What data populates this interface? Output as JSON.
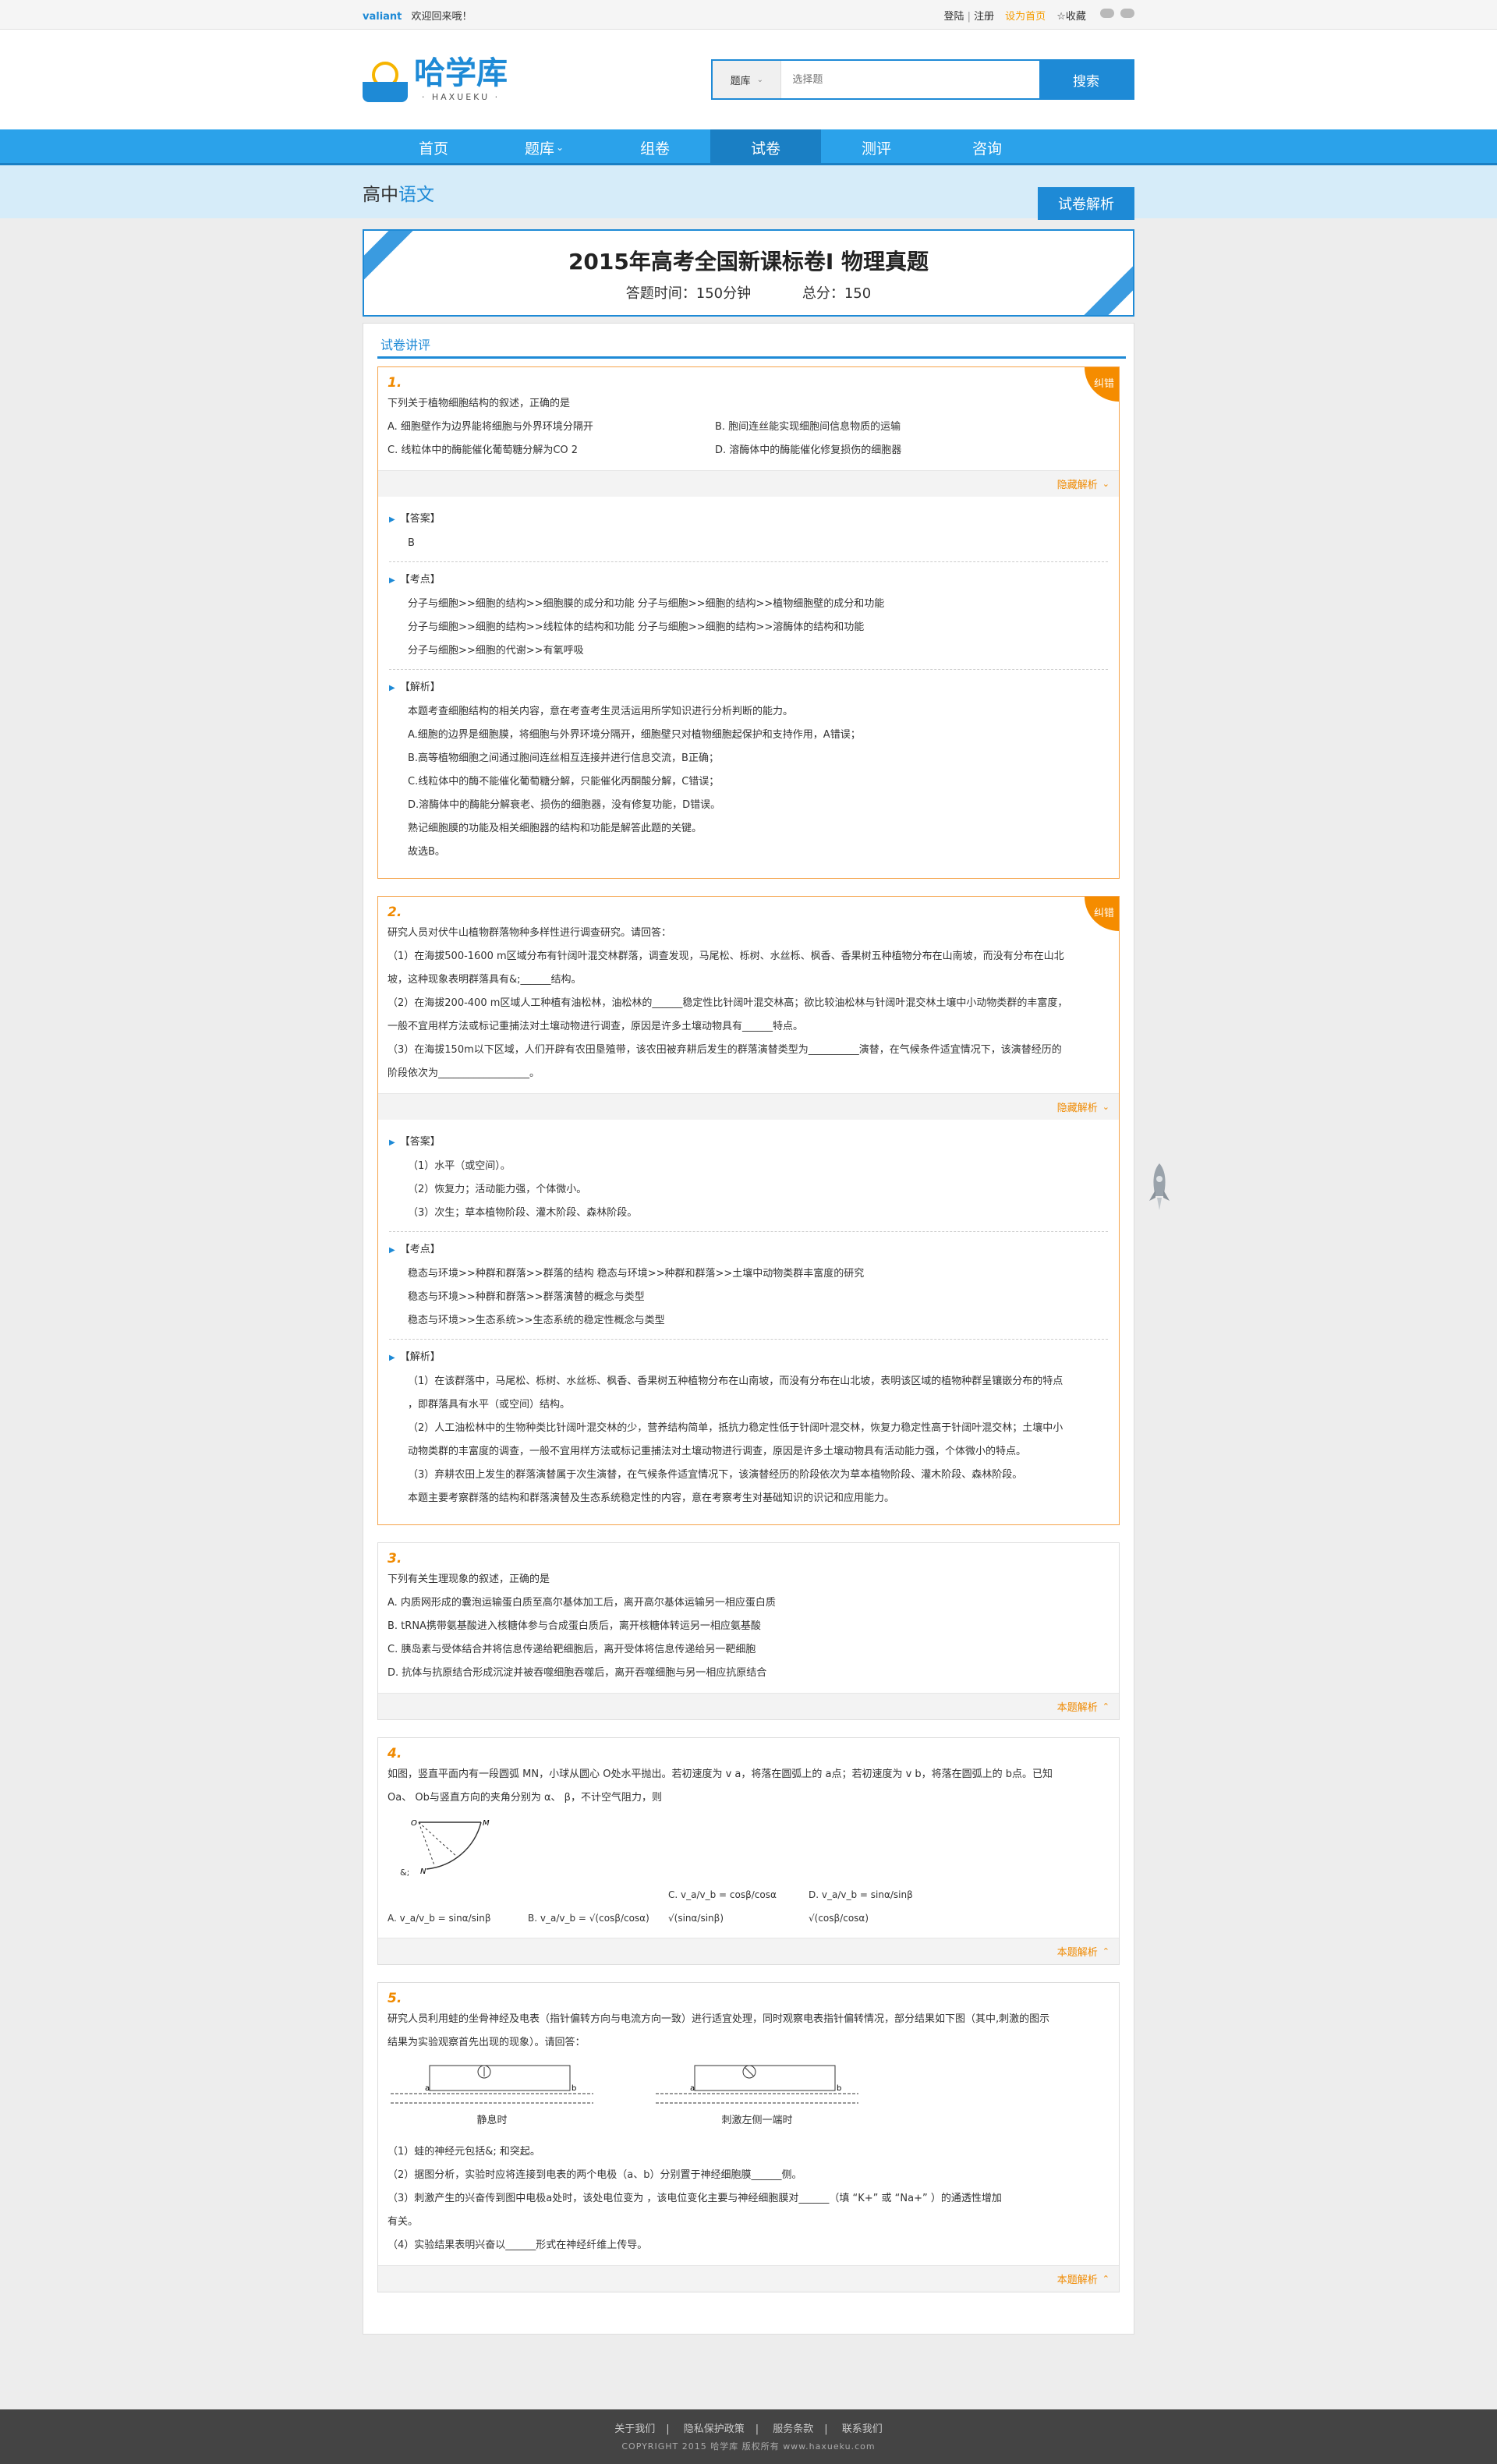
{
  "topbar": {
    "user": "valiant",
    "welcome": "欢迎回来哦！",
    "login": "登陆",
    "register": "注册",
    "set_home": "设为首页",
    "favorite": "收藏"
  },
  "header": {
    "logo_text": "哈学库",
    "logo_sub": "· HAXUEKU ·",
    "search_category": "题库",
    "search_placeholder": "选择题",
    "search_button": "搜索"
  },
  "nav": [
    "首页",
    "题库",
    "组卷",
    "试卷",
    "测评",
    "咨询"
  ],
  "nav_active": "试卷",
  "subhead": {
    "grade": "高中",
    "subject": "语文",
    "tag": "试卷解析"
  },
  "paper": {
    "title": "2015年高考全国新课标卷Ⅰ  物理真题",
    "time": "答题时间：150分钟",
    "score": "总分：150"
  },
  "section_title": "试卷讲评",
  "q1": {
    "num": "1.",
    "badge": "纠错",
    "stem": "下列关于植物细胞结构的叙述，正确的是",
    "opts": [
      "A.  细胞壁作为边界能将细胞与外界环境分隔开",
      "B.  胞间连丝能实现细胞间信息物质的运输",
      "C.  线粒体中的酶能催化葡萄糖分解为CO 2",
      "D.  溶酶体中的酶能催化修复损伤的细胞器"
    ],
    "toggle": "隐藏解析",
    "answer_h": "【答案】",
    "answer": [
      "B"
    ],
    "point_h": "【考点】",
    "points": [
      "分子与细胞>>细胞的结构>>细胞膜的成分和功能 分子与细胞>>细胞的结构>>植物细胞壁的成分和功能",
      "分子与细胞>>细胞的结构>>线粒体的结构和功能 分子与细胞>>细胞的结构>>溶酶体的结构和功能",
      "分子与细胞>>细胞的代谢>>有氧呼吸"
    ],
    "ana_h": "【解析】",
    "ana": [
      "本题考查细胞结构的相关内容，意在考查考生灵活运用所学知识进行分析判断的能力。",
      "A.细胞的边界是细胞膜，将细胞与外界环境分隔开，细胞壁只对植物细胞起保护和支持作用，A错误；",
      "B.高等植物细胞之间通过胞间连丝相互连接并进行信息交流，B正确；",
      "C.线粒体中的酶不能催化葡萄糖分解，只能催化丙酮酸分解，C错误；",
      "D.溶酶体中的酶能分解衰老、损伤的细胞器，没有修复功能，D错误。",
      "熟记细胞膜的功能及相关细胞器的结构和功能是解答此题的关键。",
      "故选B。"
    ]
  },
  "q2": {
    "num": "2.",
    "badge": "纠错",
    "lines": [
      "研究人员对伏牛山植物群落物种多样性进行调查研究。请回答：",
      "（1）在海拔500-1600 m区域分布有针阔叶混交林群落，调查发现，马尾松、栎树、水丝栎、枫香、香果树五种植物分布在山南坡，而没有分布在山北",
      "坡，这种现象表明群落具有&;______结构。",
      "（2）在海拔200-400 m区域人工种植有油松林，油松林的______稳定性比针阔叶混交林高；欲比较油松林与针阔叶混交林土壤中小动物类群的丰富度，",
      "一般不宜用样方法或标记重捕法对土壤动物进行调查，原因是许多土壤动物具有______特点。",
      "（3）在海拔150m以下区域，人们开辟有农田垦殖带，该农田被弃耕后发生的群落演替类型为__________演替，在气候条件适宜情况下，该演替经历的",
      "阶段依次为__________________。"
    ],
    "toggle": "隐藏解析",
    "answer_h": "【答案】",
    "answer": [
      "（1）水平（或空间）。",
      "（2）恢复力；活动能力强，个体微小。",
      "（3）次生；草本植物阶段、灌木阶段、森林阶段。"
    ],
    "point_h": "【考点】",
    "points": [
      "稳态与环境>>种群和群落>>群落的结构 稳态与环境>>种群和群落>>土壤中动物类群丰富度的研究",
      "稳态与环境>>种群和群落>>群落演替的概念与类型",
      "稳态与环境>>生态系统>>生态系统的稳定性概念与类型"
    ],
    "ana_h": "【解析】",
    "ana": [
      "（1）在该群落中，马尾松、栎树、水丝栎、枫香、香果树五种植物分布在山南坡，而没有分布在山北坡，表明该区域的植物种群呈镶嵌分布的特点",
      "，即群落具有水平（或空间）结构。",
      "（2）人工油松林中的生物种类比针阔叶混交林的少，营养结构简单，抵抗力稳定性低于针阔叶混交林，恢复力稳定性高于针阔叶混交林；土壤中小",
      "动物类群的丰富度的调查，一般不宜用样方法或标记重捕法对土壤动物进行调查，原因是许多土壤动物具有活动能力强，个体微小的特点。",
      "（3）弃耕农田上发生的群落演替属于次生演替，在气候条件适宜情况下，该演替经历的阶段依次为草本植物阶段、灌木阶段、森林阶段。",
      "本题主要考察群落的结构和群落演替及生态系统稳定性的内容，意在考察考生对基础知识的识记和应用能力。"
    ]
  },
  "q3": {
    "num": "3.",
    "stem": "下列有关生理现象的叙述，正确的是",
    "opts": [
      "A.   内质网形成的囊泡运输蛋白质至高尔基体加工后，离开高尔基体运输另一相应蛋白质",
      "B.   tRNA携带氨基酸进入核糖体参与合成蛋白质后，离开核糖体转运另一相应氨基酸",
      "C.   胰岛素与受体结合并将信息传递给靶细胞后，离开受体将信息传递给另一靶细胞",
      "D.   抗体与抗原结合形成沉淀并被吞噬细胞吞噬后，离开吞噬细胞与另一相应抗原结合"
    ],
    "toggle": "本题解析"
  },
  "q4": {
    "num": "4.",
    "lines": [
      "如图，竖直平面内有一段圆弧 MN，小球从圆心 O处水平抛出。若初速度为 v a，将落在圆弧上的 a点；若初速度为 v b，将落在圆弧上的 b点。已知",
      "Oa、 Ob与竖直方向的夹角分别为 α、 β，不计空气阻力，则"
    ],
    "fig_label": "&;",
    "formulas": [
      "A.   v_a/v_b = sinα/sinβ",
      "B.   v_a/v_b = √(cosβ/cosα)",
      "C.   v_a/v_b = cosβ/cosα √(sinα/sinβ)",
      "D.   v_a/v_b = sinα/sinβ √(cosβ/cosα)"
    ],
    "toggle": "本题解析"
  },
  "q5": {
    "num": "5.",
    "lines": [
      "研究人员利用蛙的坐骨神经及电表（指针偏转方向与电流方向一致）进行适宜处理，同时观察电表指针偏转情况，部分结果如下图（其中,刺激的图示",
      "结果为实验观察首先出现的现象）。请回答："
    ],
    "fig1": "静息时",
    "fig2": "刺激左侧一端时",
    "after": [
      "（1）蛙的神经元包括&;              和突起。",
      "（2）据图分析，实验时应将连接到电表的两个电极（a、b）分别置于神经细胞膜______侧。",
      "（3）刺激产生的兴奋传到图中电极a处时，该处电位变为                ，该电位变化主要与神经细胞膜对______（填 “K+” 或 “Na+” ）的通透性增加",
      "有关。",
      "（4）实验结果表明兴奋以______形式在神经纤维上传导。"
    ],
    "toggle": "本题解析"
  },
  "footer": {
    "links": [
      "关于我们",
      "隐私保护政策",
      "服务条款",
      "联系我们"
    ],
    "copy": "COPYRIGHT 2015  哈学库  版权所有  www.haxueku.com"
  },
  "colors": {
    "brand_blue": "#1e8ad6",
    "nav_blue": "#2ba2ea",
    "accent_orange": "#f58c00"
  }
}
